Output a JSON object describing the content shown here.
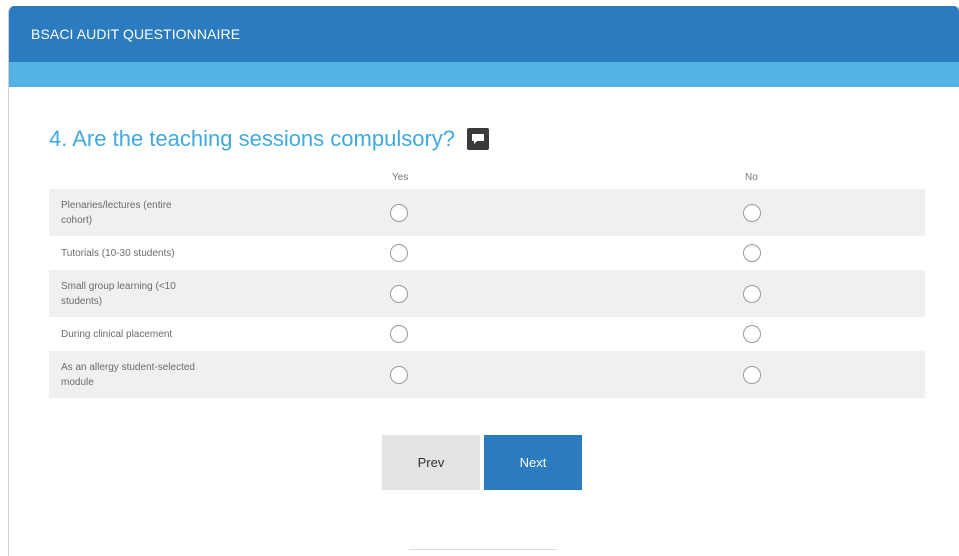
{
  "header": {
    "title": "BSACI AUDIT QUESTIONNAIRE"
  },
  "question": {
    "text": "4. Are the teaching sessions compulsory?",
    "icon": "comment-icon"
  },
  "columns": [
    "Yes",
    "No"
  ],
  "rows": [
    {
      "label": "Plenaries/lectures (entire cohort)"
    },
    {
      "label": "Tutorials (10-30 students)"
    },
    {
      "label": "Small group learning (<10 students)"
    },
    {
      "label": "During clinical placement"
    },
    {
      "label": "As an allergy student-selected module"
    }
  ],
  "buttons": {
    "prev": "Prev",
    "next": "Next"
  },
  "colors": {
    "header": "#2a7bbf",
    "subbar": "#54b3e2",
    "question": "#3fa9e0",
    "next_button": "#2a7bbf",
    "prev_button": "#e3e3e3"
  }
}
